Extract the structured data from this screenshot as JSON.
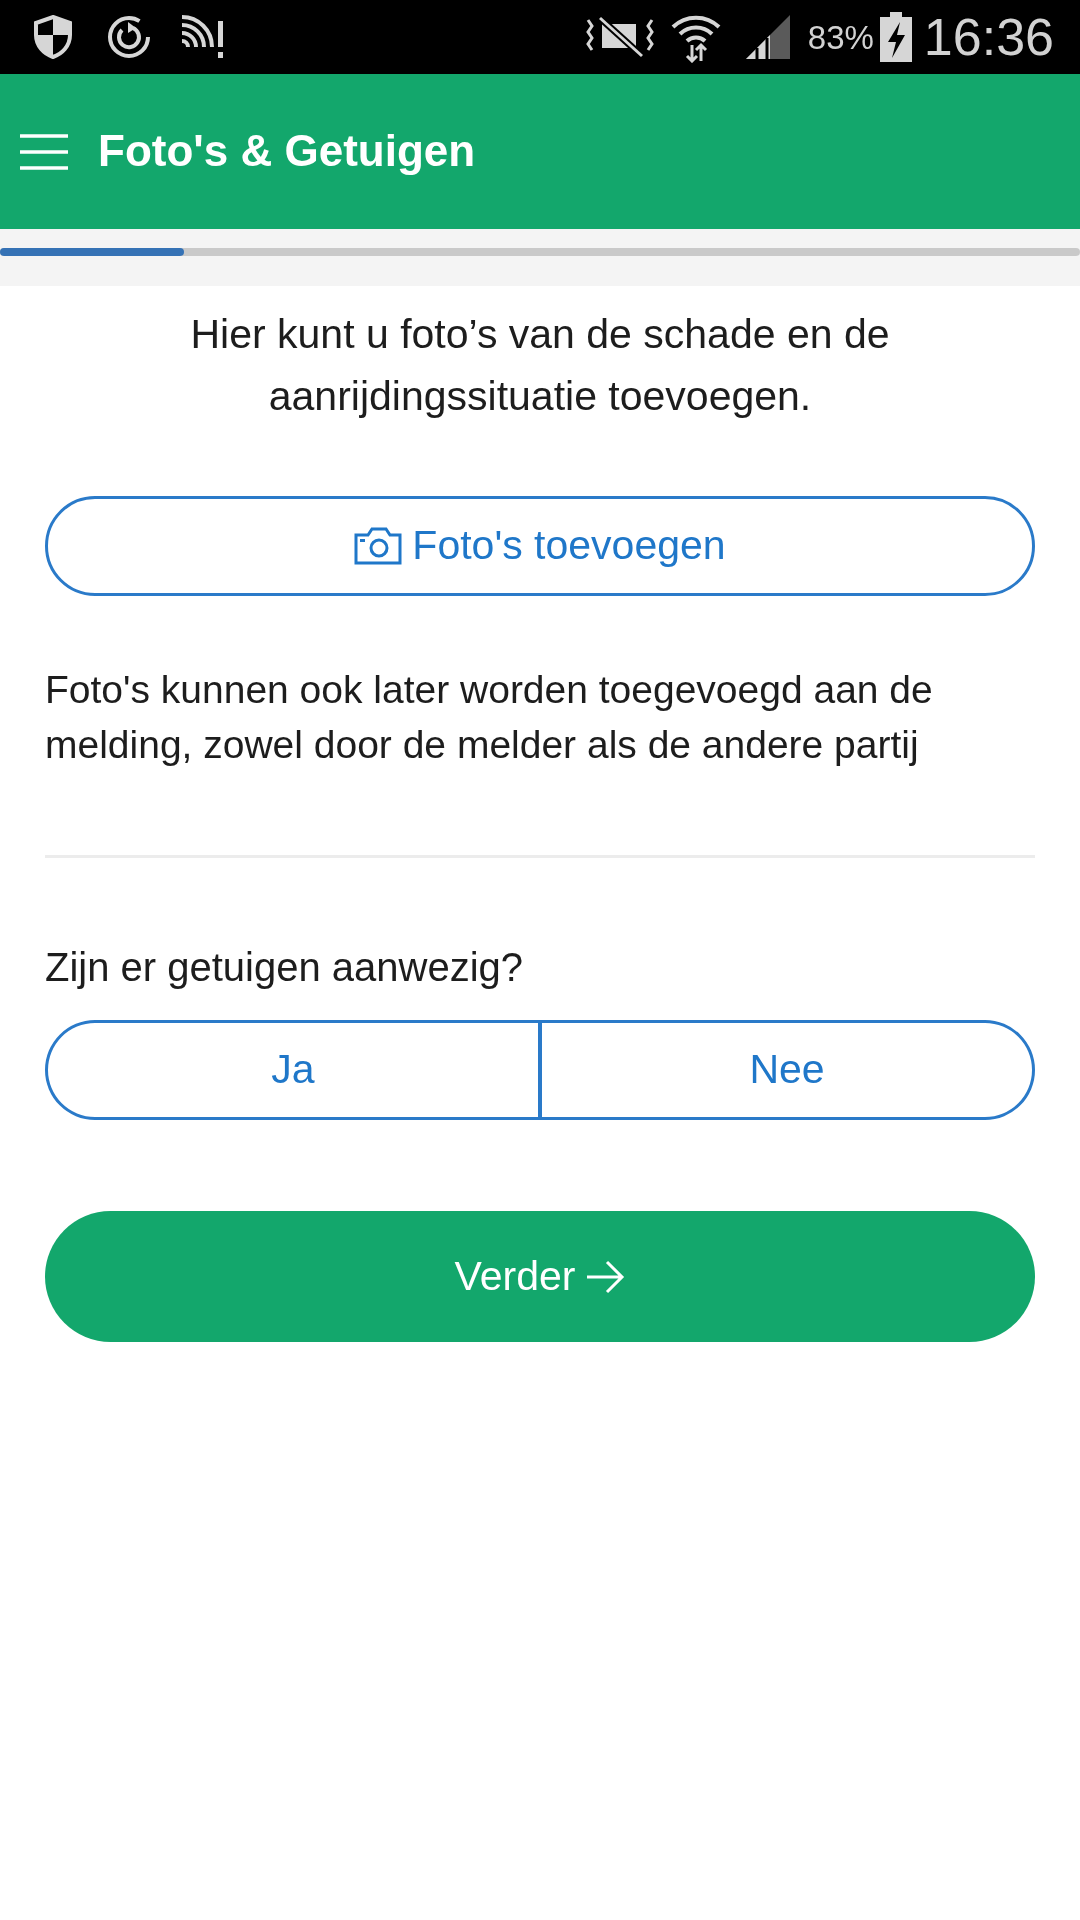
{
  "status_bar": {
    "battery": "83%",
    "time": "16:36"
  },
  "app_bar": {
    "title": "Foto's & Getuigen"
  },
  "progress": {
    "level": 0.17
  },
  "intro": "Hier kunt u foto’s van de schade en de aanrijdingssituatie toevoegen.",
  "add_photos_button": {
    "label": "Foto's toevoegen"
  },
  "photo_note": "Foto's kunnen ook later worden toegevoegd aan de melding, zowel door de melder als de andere partij",
  "witnesses": {
    "question": "Zijn er getuigen aanwezig?",
    "options": [
      {
        "label": "Ja",
        "selected": false
      },
      {
        "label": "Nee",
        "selected": false
      }
    ]
  },
  "next_button": {
    "label": "Verder"
  }
}
